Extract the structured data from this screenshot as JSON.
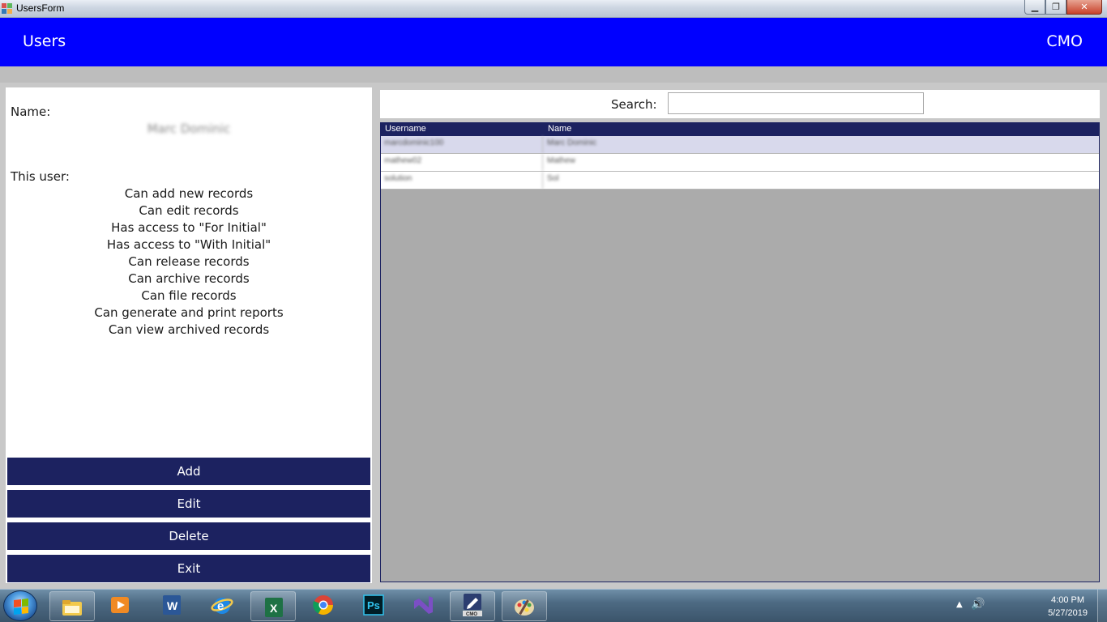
{
  "window": {
    "title": "UsersForm",
    "minimize_label": "▁",
    "maximize_label": "❐",
    "close_label": "✕"
  },
  "header": {
    "title": "Users",
    "org": "CMO"
  },
  "details": {
    "name_label": "Name:",
    "name_value": "Marc Dominic",
    "this_user_label": "This user:",
    "permissions": [
      "Can add new records",
      "Can edit records",
      "Has access to \"For Initial\"",
      "Has access to \"With Initial\"",
      "Can release records",
      "Can archive records",
      "Can file records",
      "Can generate and print reports",
      "Can view archived records"
    ]
  },
  "actions": {
    "add": "Add",
    "edit": "Edit",
    "delete": "Delete",
    "exit": "Exit"
  },
  "search": {
    "label": "Search:",
    "value": ""
  },
  "grid": {
    "columns": [
      "Username",
      "Name"
    ],
    "rows": [
      {
        "username": "marcdominic100",
        "name": "Marc Dominic"
      },
      {
        "username": "mathew02",
        "name": "Mathew"
      },
      {
        "username": "solution",
        "name": "Sol"
      }
    ],
    "selected_index": 0
  },
  "taskbar": {
    "apps": [
      "file-explorer",
      "media-player",
      "word",
      "internet-explorer",
      "excel",
      "chrome",
      "photoshop",
      "visual-studio",
      "cmo-app",
      "paint"
    ],
    "excel_label": "X",
    "word_label": "W",
    "photoshop_label": "Ps",
    "cmo_label": "CMO",
    "time": "4:00 PM",
    "date": "5/27/2019"
  },
  "colors": {
    "header_blue": "#0000ff",
    "button_navy": "#1c2260",
    "grid_background": "#ababab",
    "selected_row": "#d8d9ec"
  }
}
